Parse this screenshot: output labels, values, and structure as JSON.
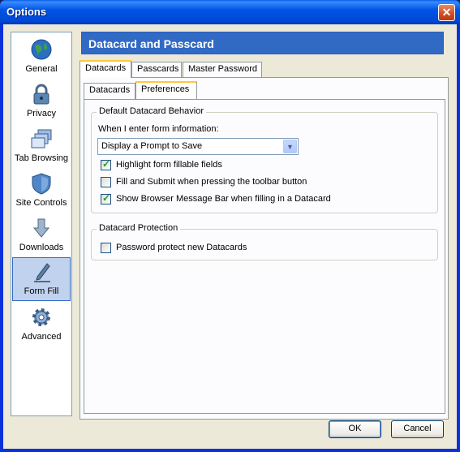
{
  "window": {
    "title": "Options"
  },
  "sidebar": {
    "items": [
      {
        "label": "General",
        "icon": "globe-icon"
      },
      {
        "label": "Privacy",
        "icon": "lock-icon"
      },
      {
        "label": "Tab Browsing",
        "icon": "tabs-icon"
      },
      {
        "label": "Site Controls",
        "icon": "shield-icon"
      },
      {
        "label": "Downloads",
        "icon": "download-arrow-icon"
      },
      {
        "label": "Form Fill",
        "icon": "pen-icon",
        "selected": true
      },
      {
        "label": "Advanced",
        "icon": "gear-icon"
      }
    ]
  },
  "header": {
    "title": "Datacard and Passcard"
  },
  "tabs": {
    "datacards": "Datacards",
    "passcards": "Passcards",
    "master_password": "Master Password"
  },
  "subtabs": {
    "datacards": "Datacards",
    "preferences": "Preferences"
  },
  "behavior": {
    "legend": "Default Datacard Behavior",
    "prompt_label": "When I enter form information:",
    "select_value": "Display a Prompt to Save",
    "options": [
      {
        "label": "Highlight form fillable fields",
        "checked": true
      },
      {
        "label": "Fill and Submit when pressing the toolbar button",
        "checked": false
      },
      {
        "label": "Show Browser Message Bar when filling in a Datacard",
        "checked": true
      }
    ]
  },
  "protection": {
    "legend": "Datacard Protection",
    "options": [
      {
        "label": "Password protect new Datacards",
        "checked": false
      }
    ]
  },
  "buttons": {
    "ok": "OK",
    "cancel": "Cancel"
  },
  "colors": {
    "header_bg": "#316ac5",
    "selection_bg": "#c1d2ee",
    "tab_highlight": "#ffc83c"
  }
}
